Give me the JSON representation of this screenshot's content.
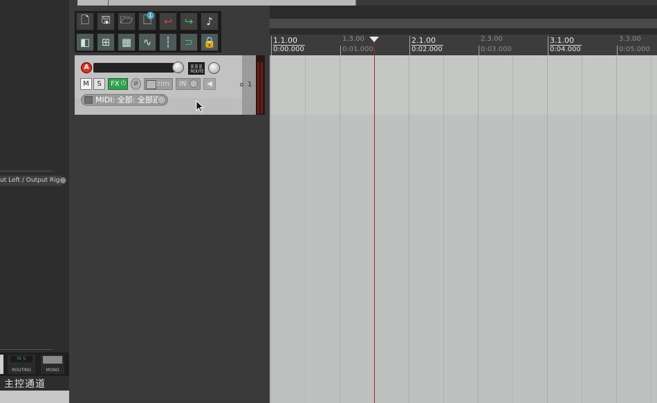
{
  "window": {
    "top_scroll": "horizontal-scrollbar"
  },
  "toolbar": {
    "buttons_row1": [
      {
        "icon": "new-track-icon",
        "glyph": "🗋"
      },
      {
        "icon": "save-project-icon",
        "glyph": "🖫"
      },
      {
        "icon": "open-project-icon",
        "glyph": "🗁"
      },
      {
        "icon": "track-template-icon",
        "glyph": "🗋"
      },
      {
        "icon": "undo-icon",
        "glyph": "↩"
      },
      {
        "icon": "redo-icon",
        "glyph": "↪"
      },
      {
        "icon": "metronome-icon",
        "glyph": "♪"
      }
    ],
    "buttons_row2": [
      {
        "icon": "snap-icon",
        "glyph": "◧"
      },
      {
        "icon": "grid-icon",
        "glyph": "⊞"
      },
      {
        "icon": "item-grouping-icon",
        "glyph": "▦"
      },
      {
        "icon": "envelope-points-icon",
        "glyph": "∿"
      },
      {
        "icon": "grid-lines-icon",
        "glyph": "┆"
      },
      {
        "icon": "loop-icon",
        "glyph": "⊃"
      },
      {
        "icon": "lock-icon",
        "glyph": "🔒"
      }
    ],
    "badge_number": "1"
  },
  "track": {
    "number": "1",
    "record_arm_label": "A",
    "route_label": "ROUTE",
    "mute_label": "M",
    "solo_label": "S",
    "fx_label": "FX",
    "fx_power": "⏻",
    "phase_glyph": "ø",
    "trim_label": "trim",
    "input_label": "IN",
    "monitor_glyph": "◀",
    "midi_input": "MIDI: 全部: 全部通"
  },
  "master": {
    "output_label": "ut Left / Output Rig",
    "routing_label": "ROUTING",
    "routing_mini": "M  S",
    "mono_label": "MONO",
    "title": "主控通道"
  },
  "ruler": {
    "markers": [
      {
        "bar": "1.1.00",
        "time": "0:00.000",
        "major": true
      },
      {
        "bar": "1.3.00",
        "time": "0:01.000",
        "major": false
      },
      {
        "bar": "2.1.00",
        "time": "0:02.000",
        "major": true
      },
      {
        "bar": "2.3.00",
        "time": "0:03.000",
        "major": false
      },
      {
        "bar": "3.1.00",
        "time": "0:04.000",
        "major": true
      },
      {
        "bar": "3.3.00",
        "time": "0:05.000",
        "major": false
      }
    ]
  },
  "colors": {
    "record_arm": "#e12d1d",
    "fx_active": "#2fa24b",
    "play_cursor": "#9a2a1e"
  }
}
